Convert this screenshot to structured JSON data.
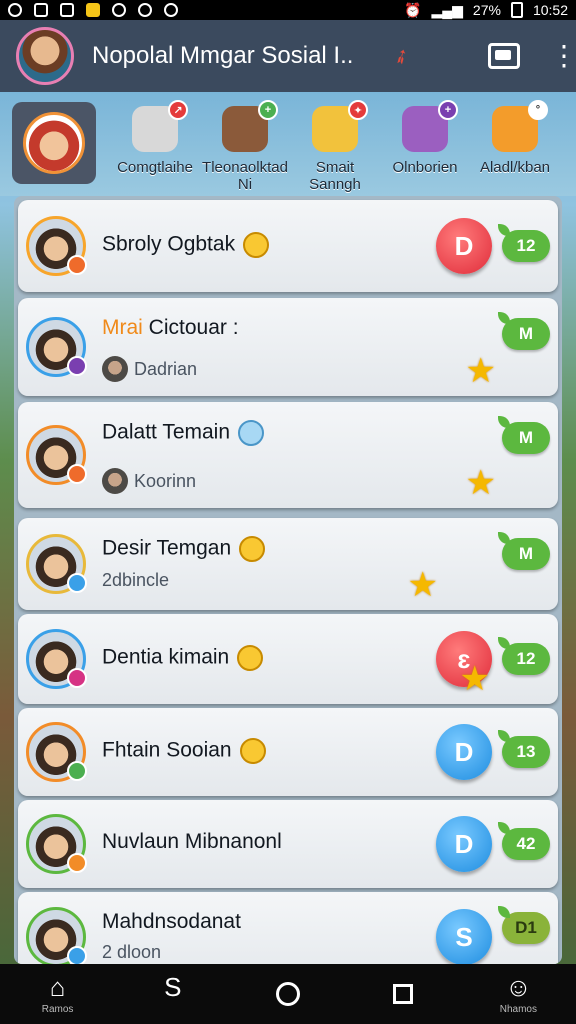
{
  "status": {
    "battery": "27%",
    "time": "10:52"
  },
  "header": {
    "title": "Nopolal Mmgar Sosial I..",
    "menu_glyph": "⋮"
  },
  "stories": [
    {
      "label": "Comgtlaihe",
      "color": "#d8d8d8",
      "badge_color": "#e43b3b",
      "badge": "↗"
    },
    {
      "label": "Tleonaolktad\nNi",
      "color": "#8b5a3a",
      "badge_color": "#4caf50",
      "badge": "+"
    },
    {
      "label": "Smait\nSanngh",
      "color": "#f2c23c",
      "badge_color": "#e43b3b",
      "badge": "✦"
    },
    {
      "label": "Olnborien",
      "color": "#9b5fc0",
      "badge_color": "#7a3fb0",
      "badge": "+"
    },
    {
      "label": "Aladl/kban",
      "color": "#f39c2b",
      "badge_color": "#ffffff",
      "badge": "°"
    }
  ],
  "contacts": [
    {
      "name": "Sbroly Ogbtak",
      "name_prefix": "",
      "sub": "",
      "count": "12",
      "action": "D",
      "action_color": "red",
      "ring": "#f7a52b",
      "mini": "#ef6b2b"
    },
    {
      "name": "Cictouar :",
      "name_prefix": "Mrai",
      "sub": "Dadrian",
      "count": "M",
      "action": "",
      "action_color": "",
      "ring": "#3aa0e8",
      "mini": "#7a3fb0"
    },
    {
      "name": "Dalatt Temain",
      "name_prefix": "",
      "sub": "Koorinn",
      "count": "M",
      "action": "",
      "action_color": "",
      "ring": "#f28c28",
      "mini": "#ef6b2b"
    },
    {
      "name": "Desir Temgan",
      "name_prefix": "",
      "sub": "2dbincle",
      "count": "M",
      "action": "",
      "action_color": "",
      "ring": "#e8b93a",
      "mini": "#3aa0e8"
    },
    {
      "name": "Dentia kimain",
      "name_prefix": "",
      "sub": "",
      "count": "12",
      "action": "ԑ",
      "action_color": "red",
      "ring": "#3aa0e8",
      "mini": "#d63384"
    },
    {
      "name": "Fhtain Sooian",
      "name_prefix": "",
      "sub": "",
      "count": "13",
      "action": "D",
      "action_color": "blue",
      "ring": "#f28c28",
      "mini": "#4caf50"
    },
    {
      "name": "Nuvlaun Mibnanonl",
      "name_prefix": "",
      "sub": "",
      "count": "42",
      "action": "D",
      "action_color": "blue",
      "ring": "#5cb83f",
      "mini": "#f28c28"
    },
    {
      "name": "Mahdnsodanat",
      "name_prefix": "",
      "sub": "2 dloon",
      "count": "D1",
      "action": "S",
      "action_color": "blue",
      "ring": "#5cb83f",
      "mini": "#3aa0e8"
    }
  ],
  "nav": {
    "home_label": "Ramos",
    "s_glyph": "S",
    "profile_label": "Nhamos"
  }
}
